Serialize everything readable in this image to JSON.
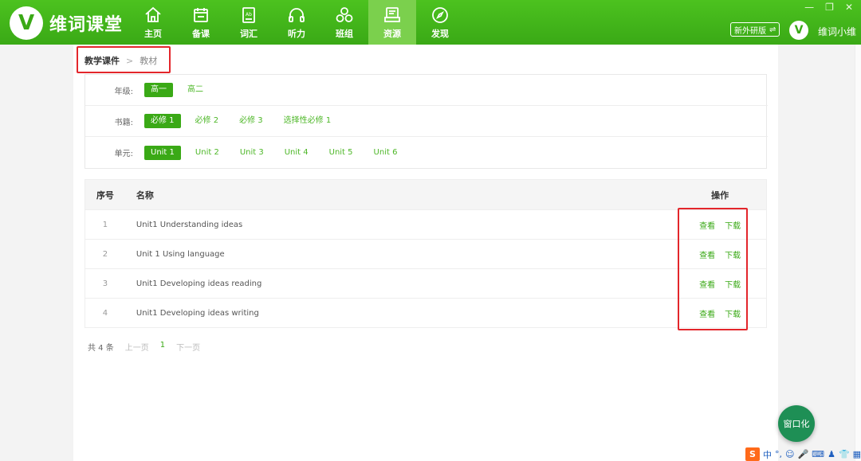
{
  "app": {
    "logo_letter": "V",
    "name": "维词课堂"
  },
  "nav": [
    {
      "label": "主页",
      "icon": "home-icon"
    },
    {
      "label": "备课",
      "icon": "calendar-icon"
    },
    {
      "label": "词汇",
      "icon": "book-icon"
    },
    {
      "label": "听力",
      "icon": "headphones-icon"
    },
    {
      "label": "班组",
      "icon": "group-icon"
    },
    {
      "label": "资源",
      "icon": "resource-icon",
      "active": true
    },
    {
      "label": "发现",
      "icon": "compass-icon"
    }
  ],
  "window_controls": {
    "minimize": "—",
    "restore": "❐",
    "close": "✕"
  },
  "header": {
    "edition": "新外研版",
    "edition_icon": "⇌",
    "avatar_letter": "V",
    "username": "维词小维"
  },
  "breadcrumb": {
    "parent": "教学课件",
    "separator": ">",
    "current": "教材"
  },
  "filters": {
    "grade": {
      "label": "年级:",
      "options": [
        "高一",
        "高二"
      ],
      "selected": 0
    },
    "book": {
      "label": "书籍:",
      "options": [
        "必修 1",
        "必修 2",
        "必修 3",
        "选择性必修 1"
      ],
      "selected": 0
    },
    "unit": {
      "label": "单元:",
      "options": [
        "Unit 1",
        "Unit 2",
        "Unit 3",
        "Unit 4",
        "Unit 5",
        "Unit 6"
      ],
      "selected": 0
    }
  },
  "table": {
    "headers": {
      "no": "序号",
      "name": "名称",
      "op": "操作"
    },
    "rows": [
      {
        "no": "1",
        "name": "Unit1 Understanding ideas",
        "view": "查看",
        "download": "下载"
      },
      {
        "no": "2",
        "name": "Unit 1 Using language",
        "view": "查看",
        "download": "下载"
      },
      {
        "no": "3",
        "name": "Unit1 Developing ideas reading",
        "view": "查看",
        "download": "下载"
      },
      {
        "no": "4",
        "name": "Unit1 Developing ideas writing",
        "view": "查看",
        "download": "下载"
      }
    ]
  },
  "pager": {
    "total": "共 4 条",
    "prev": "上一页",
    "current": "1",
    "next": "下一页"
  },
  "fab": {
    "label": "窗口化"
  },
  "ime": {
    "logo": "S",
    "mode": "中",
    "punct": "°,"
  },
  "colors": {
    "brand": "#3aa916",
    "highlight": "#e3262b"
  }
}
